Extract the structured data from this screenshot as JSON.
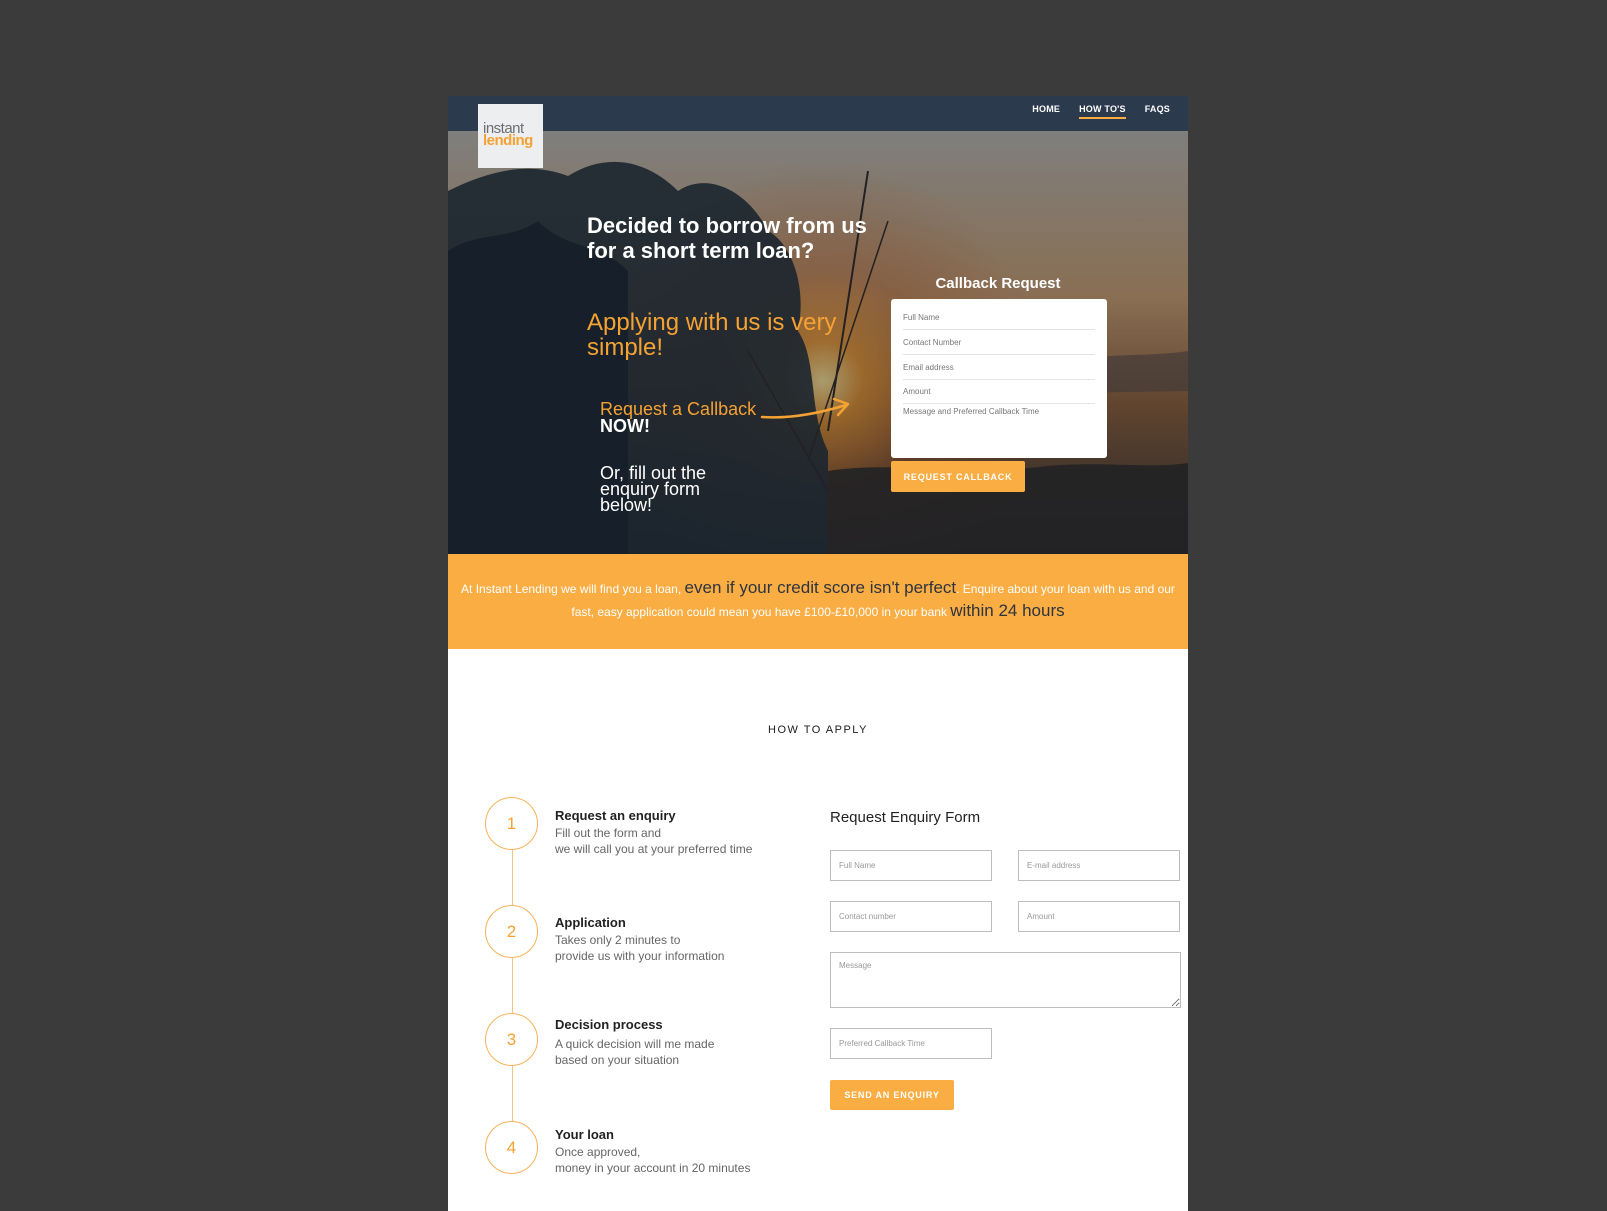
{
  "nav": {
    "items": [
      {
        "label": "HOME",
        "active": false
      },
      {
        "label": "HOW TO'S",
        "active": true
      },
      {
        "label": "FAQS",
        "active": false
      }
    ]
  },
  "logo": {
    "line1": "instant",
    "line2": "lending"
  },
  "hero": {
    "headline": "Decided to borrow from us for a short term loan?",
    "subheadline": "Applying with us is very simple!",
    "cta_part1": "Request a Callback ",
    "cta_part2": "NOW!",
    "cta_alt": "Or, fill out the enquiry form below!"
  },
  "callback": {
    "title": "Callback Request",
    "full_name_placeholder": "Full Name",
    "contact_placeholder": "Contact Number",
    "email_placeholder": "Email address",
    "amount_placeholder": "Amount",
    "message_placeholder": "Message and Preferred Callback Time",
    "button": "REQUEST CALLBACK"
  },
  "banner": {
    "part1": "At Instant Lending we will find you a loan, ",
    "highlight1": "even if your credit score isn't perfect",
    "part2": ". Enquire about your loan with us and our fast, easy application could mean you have £100-£10,000 in your bank ",
    "highlight2": "within 24 hours"
  },
  "how_to_apply": {
    "title": "HOW TO APPLY",
    "steps": [
      {
        "number": "1",
        "title": "Request an enquiry",
        "line1": "Fill out the form and",
        "line2": "we will call you at your preferred time"
      },
      {
        "number": "2",
        "title": "Application",
        "line1": "Takes only 2 minutes to",
        "line2": "provide us with your information"
      },
      {
        "number": "3",
        "title": "Decision process",
        "line1": "A quick decision will me made",
        "line2": "based on your situation"
      },
      {
        "number": "4",
        "title": "Your loan",
        "line1": "Once approved,",
        "line2": "money in your account in 20 minutes"
      }
    ]
  },
  "enquiry_form": {
    "title": "Request Enquiry Form",
    "full_name_placeholder": "Full Name",
    "email_placeholder": "E-mail address",
    "contact_placeholder": "Contact number",
    "amount_placeholder": "Amount",
    "message_placeholder": "Message",
    "callback_time_placeholder": "Preferred Callback Time",
    "button": "SEND AN ENQUIRY"
  },
  "colors": {
    "accent": "#f9ad43",
    "nav_bg": "#2c3a4e",
    "backdrop": "#3a3b3a"
  }
}
